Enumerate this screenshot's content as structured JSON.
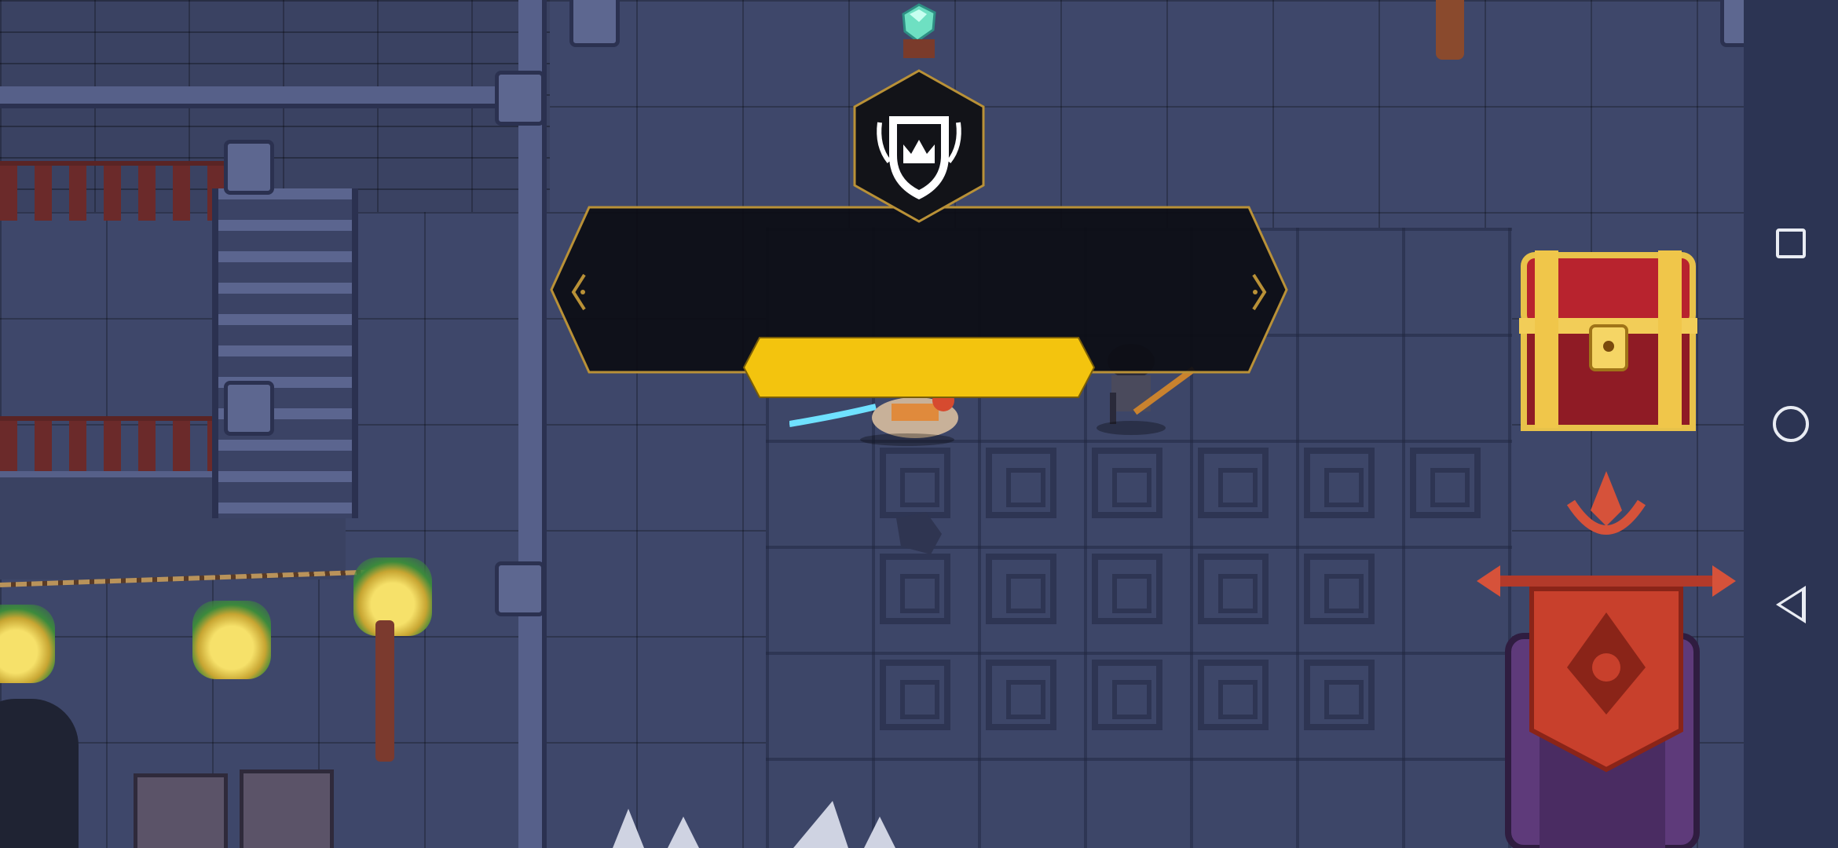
{
  "scene": {
    "name": "Dungeon hub",
    "colors": {
      "floor": "#3e476a",
      "wall": "#3a4262",
      "gold": "#d4a93a",
      "modal_bg": "#0e0f16",
      "button_yellow": "#f3c40e",
      "banner_red": "#c8402c"
    }
  },
  "modal": {
    "badge_icon": "crown-shield-icon",
    "message": "",
    "confirm_label": "",
    "prev_icon": "chevron-left-icon",
    "next_icon": "chevron-right-icon"
  },
  "objects": {
    "chest_icon": "treasure-chest-icon",
    "banner_icon": "war-banner-icon",
    "gem_icon": "gem-icon",
    "lantern_icon": "lantern-icon"
  },
  "system_nav": {
    "recent_icon": "square-icon",
    "home_icon": "circle-icon",
    "back_icon": "triangle-back-icon"
  }
}
